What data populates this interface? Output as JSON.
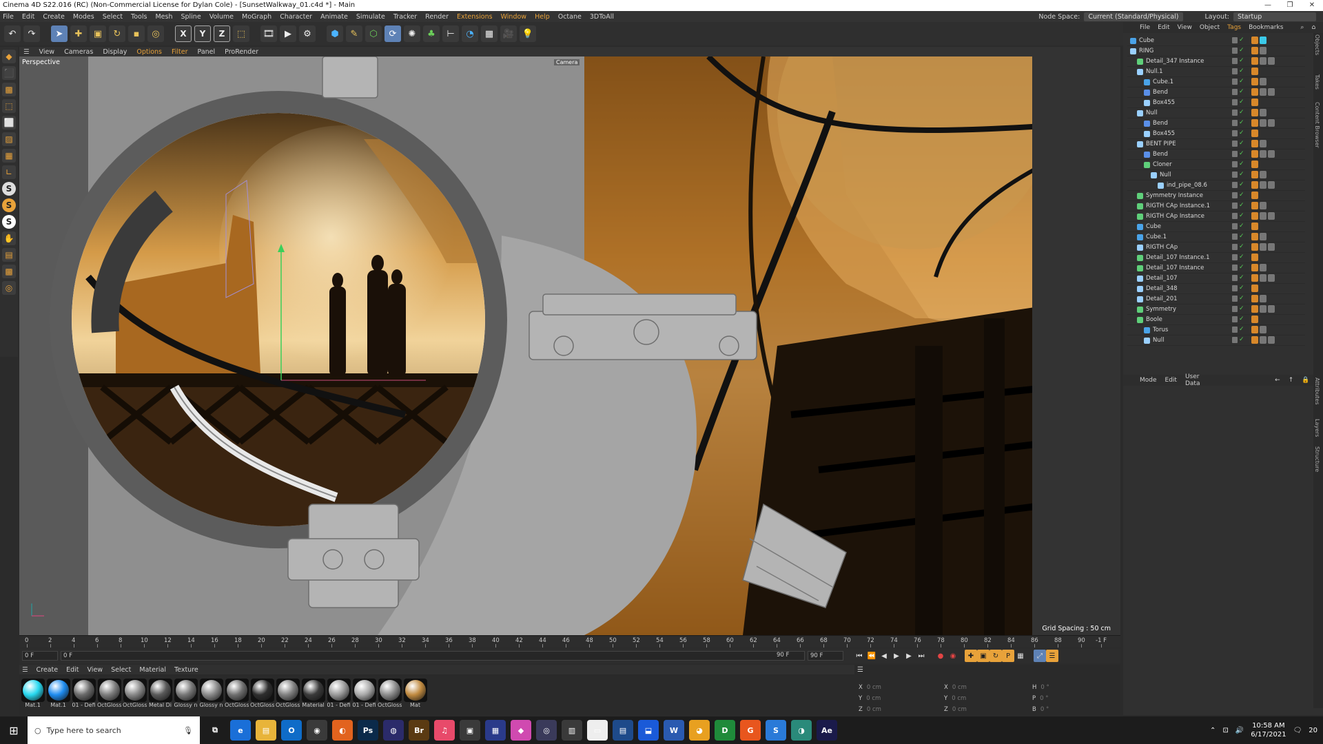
{
  "window": {
    "title": "Cinema 4D S22.016 (RC) (Non-Commercial License for Dylan Cole) - [SunsetWalkway_01.c4d *] - Main"
  },
  "menubar": {
    "items": [
      "File",
      "Edit",
      "Create",
      "Modes",
      "Select",
      "Tools",
      "Mesh",
      "Spline",
      "Volume",
      "MoGraph",
      "Character",
      "Animate",
      "Simulate",
      "Tracker",
      "Render",
      "Extensions",
      "Window",
      "Help",
      "Octane",
      "3DToAll"
    ],
    "node_space_label": "Node Space:",
    "node_space_value": "Current (Standard/Physical)",
    "layout_label": "Layout:",
    "layout_value": "Startup"
  },
  "toolbar": {
    "axis_x": "X",
    "axis_y": "Y",
    "axis_z": "Z"
  },
  "lefttools": {
    "s1": "S",
    "s2": "S",
    "s3": "S"
  },
  "viewport": {
    "menu": [
      "View",
      "Cameras",
      "Display",
      "Options",
      "Filter",
      "Panel",
      "ProRender"
    ],
    "label": "Perspective",
    "camera_label": "Camera",
    "grid_spacing": "Grid Spacing : 50 cm"
  },
  "timeline": {
    "ticks": [
      "0",
      "2",
      "4",
      "6",
      "8",
      "10",
      "12",
      "14",
      "16",
      "18",
      "20",
      "22",
      "24",
      "26",
      "28",
      "30",
      "32",
      "34",
      "36",
      "38",
      "40",
      "42",
      "44",
      "46",
      "48",
      "50",
      "52",
      "54",
      "56",
      "58",
      "60",
      "62",
      "64",
      "66",
      "68",
      "70",
      "72",
      "74",
      "76",
      "78",
      "80",
      "82",
      "84",
      "86",
      "88",
      "90"
    ],
    "current_frame_right": "-1 F"
  },
  "playback": {
    "start": "0 F",
    "current": "0 F",
    "end": "90 F",
    "end2": "90 F"
  },
  "materials": {
    "menu": [
      "Create",
      "Edit",
      "View",
      "Select",
      "Material",
      "Texture"
    ],
    "items": [
      {
        "name": "Mat.1",
        "color": "#27d8f0"
      },
      {
        "name": "Mat.1",
        "color": "#1e8cf0"
      },
      {
        "name": "01 - Defi",
        "color": "#6a6a6a"
      },
      {
        "name": "OctGloss",
        "color": "#7d7d7d"
      },
      {
        "name": "OctGloss",
        "color": "#888888"
      },
      {
        "name": "Metal Di",
        "color": "#5a5a5a"
      },
      {
        "name": "Glossy n",
        "color": "#777777"
      },
      {
        "name": "Glossy n",
        "color": "#8a8a8a"
      },
      {
        "name": "OctGloss",
        "color": "#6f6f6f"
      },
      {
        "name": "OctGloss",
        "color": "#2e2e2e"
      },
      {
        "name": "OctGloss",
        "color": "#808080"
      },
      {
        "name": "Material",
        "color": "#3a3a3a"
      },
      {
        "name": "01 - Defi",
        "color": "#9a9a9a"
      },
      {
        "name": "01 - Defi",
        "color": "#a8a8a8"
      },
      {
        "name": "OctGloss",
        "color": "#8c8c8c"
      },
      {
        "name": "Mat",
        "color": "#c08a40"
      }
    ]
  },
  "coords": {
    "x1": "X",
    "x1v": "0 cm",
    "x2": "X",
    "x2v": "0 cm",
    "h": "H",
    "hv": "0 °",
    "y1": "Y",
    "y1v": "0 cm",
    "y2": "Y",
    "y2v": "0 cm",
    "p": "P",
    "pv": "0 °",
    "z1": "Z",
    "z1v": "0 cm",
    "z2": "Z",
    "z2v": "0 cm",
    "b": "B",
    "bv": "0 °"
  },
  "objects_panel": {
    "menu": [
      "File",
      "Edit",
      "View",
      "Object",
      "Tags",
      "Bookmarks"
    ],
    "items": [
      {
        "name": "Cube",
        "indent": 0,
        "color": "#4aa3e8"
      },
      {
        "name": "RING",
        "indent": 0,
        "color": "#9ad0ff"
      },
      {
        "name": "Detail_347 Instance",
        "indent": 1,
        "color": "#5fcf7a"
      },
      {
        "name": "Null.1",
        "indent": 1,
        "color": "#9ad0ff"
      },
      {
        "name": "Cube.1",
        "indent": 2,
        "color": "#4aa3e8"
      },
      {
        "name": "Bend",
        "indent": 2,
        "color": "#5a8fe8"
      },
      {
        "name": "Box455",
        "indent": 2,
        "color": "#9ad0ff"
      },
      {
        "name": "Null",
        "indent": 1,
        "color": "#9ad0ff"
      },
      {
        "name": "Bend",
        "indent": 2,
        "color": "#5a8fe8"
      },
      {
        "name": "Box455",
        "indent": 2,
        "color": "#9ad0ff"
      },
      {
        "name": "BENT PIPE",
        "indent": 1,
        "color": "#9ad0ff"
      },
      {
        "name": "Bend",
        "indent": 2,
        "color": "#5a8fe8"
      },
      {
        "name": "Cloner",
        "indent": 2,
        "color": "#5fcf7a"
      },
      {
        "name": "Null",
        "indent": 3,
        "color": "#9ad0ff"
      },
      {
        "name": "ind_pipe_08.6",
        "indent": 4,
        "color": "#9ad0ff"
      },
      {
        "name": "Symmetry Instance",
        "indent": 1,
        "color": "#5fcf7a"
      },
      {
        "name": "RIGTH CAp Instance.1",
        "indent": 1,
        "color": "#5fcf7a"
      },
      {
        "name": "RIGTH CAp Instance",
        "indent": 1,
        "color": "#5fcf7a"
      },
      {
        "name": "Cube",
        "indent": 1,
        "color": "#4aa3e8"
      },
      {
        "name": "Cube.1",
        "indent": 1,
        "color": "#4aa3e8"
      },
      {
        "name": "RIGTH CAp",
        "indent": 1,
        "color": "#9ad0ff"
      },
      {
        "name": "Detail_107 Instance.1",
        "indent": 1,
        "color": "#5fcf7a"
      },
      {
        "name": "Detail_107 Instance",
        "indent": 1,
        "color": "#5fcf7a"
      },
      {
        "name": "Detail_107",
        "indent": 1,
        "color": "#9ad0ff"
      },
      {
        "name": "Detail_348",
        "indent": 1,
        "color": "#9ad0ff"
      },
      {
        "name": "Detail_201",
        "indent": 1,
        "color": "#9ad0ff"
      },
      {
        "name": "Symmetry",
        "indent": 1,
        "color": "#5fcf7a"
      },
      {
        "name": "Boole",
        "indent": 1,
        "color": "#5fcf7a"
      },
      {
        "name": "Torus",
        "indent": 2,
        "color": "#4aa3e8"
      },
      {
        "name": "Null",
        "indent": 2,
        "color": "#9ad0ff"
      }
    ]
  },
  "attributes_panel": {
    "menu": [
      "Mode",
      "Edit",
      "User Data"
    ]
  },
  "side_tabs": [
    "Objects",
    "Takes",
    "Content Browser",
    "Attributes",
    "Layers",
    "Structure"
  ],
  "taskbar": {
    "search_placeholder": "Type here to search",
    "apps": [
      {
        "label": "e",
        "color": "#1a6fd8"
      },
      {
        "label": "▤",
        "color": "#e8b43a"
      },
      {
        "label": "O",
        "color": "#0f6cc8"
      },
      {
        "label": "◉",
        "color": "#3a3a3a"
      },
      {
        "label": "◐",
        "color": "#e2631e"
      },
      {
        "label": "Ps",
        "color": "#0b2a4a"
      },
      {
        "label": "◍",
        "color": "#2b2b6a"
      },
      {
        "label": "Br",
        "color": "#5a3a12"
      },
      {
        "label": "♫",
        "color": "#e84a6a"
      },
      {
        "label": "▣",
        "color": "#3a3a3a"
      },
      {
        "label": "▦",
        "color": "#2a3a8a"
      },
      {
        "label": "◆",
        "color": "#d04ab0"
      },
      {
        "label": "◎",
        "color": "#3a3a5a"
      },
      {
        "label": "▥",
        "color": "#3a3a3a"
      },
      {
        "label": "▭",
        "color": "#eeeeee"
      },
      {
        "label": "▤",
        "color": "#1e4a8a"
      },
      {
        "label": "⬓",
        "color": "#1a5ad8"
      },
      {
        "label": "W",
        "color": "#2a5ab0"
      },
      {
        "label": "◕",
        "color": "#e8a020"
      },
      {
        "label": "D",
        "color": "#1f8a3a"
      },
      {
        "label": "G",
        "color": "#e8561e"
      },
      {
        "label": "S",
        "color": "#2a7ad8"
      },
      {
        "label": "◑",
        "color": "#2a8a7a"
      },
      {
        "label": "Ae",
        "color": "#1a1a4a"
      }
    ],
    "time": "10:58 AM",
    "date": "6/17/2021",
    "notif": "20"
  }
}
